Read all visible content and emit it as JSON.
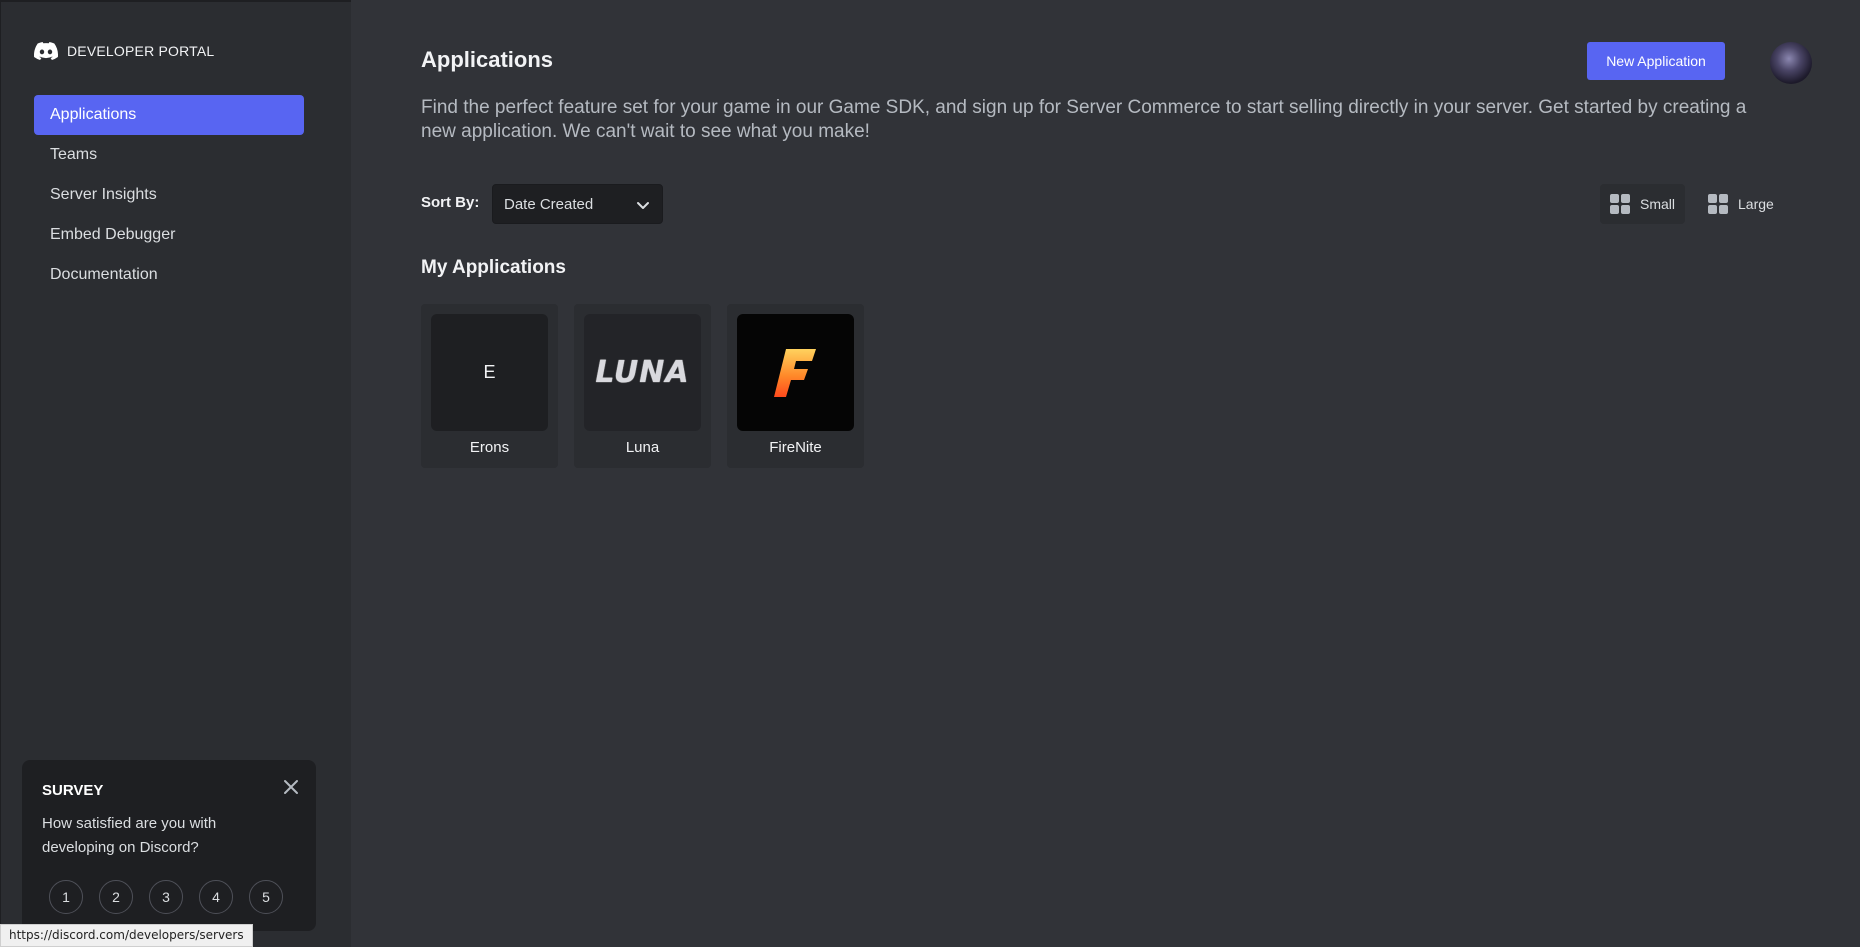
{
  "sidebar": {
    "brand": "DEVELOPER PORTAL",
    "items": [
      {
        "label": "Applications",
        "active": true
      },
      {
        "label": "Teams"
      },
      {
        "label": "Server Insights"
      },
      {
        "label": "Embed Debugger"
      },
      {
        "label": "Documentation"
      }
    ]
  },
  "header": {
    "title": "Applications",
    "new_app_label": "New Application",
    "lead": "Find the perfect feature set for your game in our Game SDK, and sign up for Server Commerce to start selling directly in your server. Get started by creating a new application. We can't wait to see what you make!"
  },
  "sort": {
    "label": "Sort By:",
    "selected": "Date Created"
  },
  "view": {
    "small_label": "Small",
    "large_label": "Large",
    "selected": "Small"
  },
  "apps_section": {
    "title": "My Applications",
    "apps": [
      {
        "name": "Erons",
        "icon_text": "E"
      },
      {
        "name": "Luna",
        "icon_text": "LUNA"
      },
      {
        "name": "FireNite",
        "icon_text": "F"
      }
    ]
  },
  "survey": {
    "title": "SURVEY",
    "question": "How satisfied are you with developing on Discord?",
    "ratings": [
      "1",
      "2",
      "3",
      "4",
      "5"
    ]
  },
  "status_bar": {
    "url": "https://discord.com/developers/servers"
  },
  "colors": {
    "accent": "#5865f2",
    "background": "#313338",
    "sidebar": "#2b2d31"
  }
}
